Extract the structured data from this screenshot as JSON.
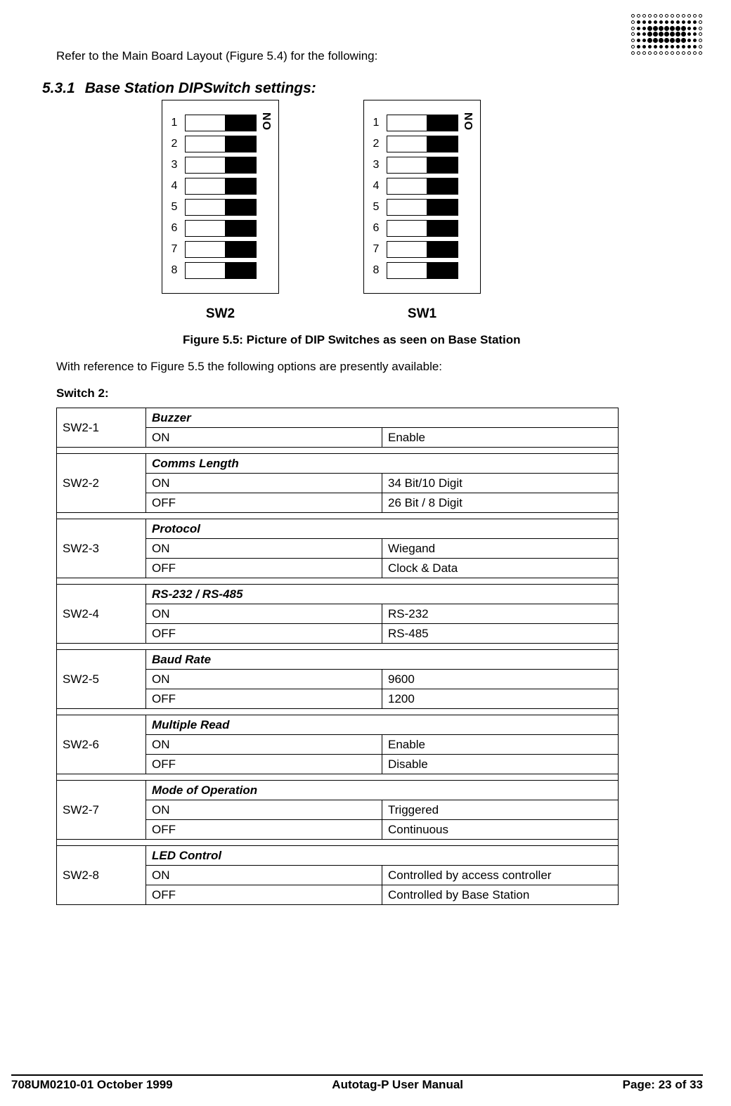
{
  "intro_text": "Refer to the Main Board Layout (Figure 5.4) for the following:",
  "section": {
    "number": "5.3.1",
    "title": "Base Station DIPSwitch settings:"
  },
  "dip": {
    "on_label": "ON",
    "sw2": {
      "name": "SW2",
      "switches": [
        {
          "n": "1",
          "state": "on"
        },
        {
          "n": "2",
          "state": "on"
        },
        {
          "n": "3",
          "state": "on"
        },
        {
          "n": "4",
          "state": "on"
        },
        {
          "n": "5",
          "state": "on"
        },
        {
          "n": "6",
          "state": "on"
        },
        {
          "n": "7",
          "state": "on"
        },
        {
          "n": "8",
          "state": "on"
        }
      ]
    },
    "sw1": {
      "name": "SW1",
      "switches": [
        {
          "n": "1",
          "state": "on"
        },
        {
          "n": "2",
          "state": "on"
        },
        {
          "n": "3",
          "state": "on"
        },
        {
          "n": "4",
          "state": "on"
        },
        {
          "n": "5",
          "state": "on"
        },
        {
          "n": "6",
          "state": "on"
        },
        {
          "n": "7",
          "state": "on"
        },
        {
          "n": "8",
          "state": "on"
        }
      ]
    }
  },
  "figure_caption": "Figure 5.5: Picture of DIP Switches as seen on Base Station",
  "para_options": "With reference to Figure 5.5 the following options are presently available:",
  "switch2_label": "Switch 2:",
  "table": [
    {
      "switch": "SW2-1",
      "title": "Buzzer",
      "rows": [
        {
          "state": "ON",
          "desc": "Enable"
        }
      ]
    },
    {
      "switch": "SW2-2",
      "title": "Comms Length",
      "rows": [
        {
          "state": "ON",
          "desc": "34 Bit/10 Digit"
        },
        {
          "state": "OFF",
          "desc": "26 Bit / 8 Digit"
        }
      ]
    },
    {
      "switch": "SW2-3",
      "title": "Protocol",
      "rows": [
        {
          "state": "ON",
          "desc": "Wiegand"
        },
        {
          "state": "OFF",
          "desc": "Clock & Data"
        }
      ]
    },
    {
      "switch": "SW2-4",
      "title": "RS-232 / RS-485",
      "rows": [
        {
          "state": "ON",
          "desc": "RS-232"
        },
        {
          "state": "OFF",
          "desc": "RS-485"
        }
      ]
    },
    {
      "switch": "SW2-5",
      "title": "Baud Rate",
      "rows": [
        {
          "state": "ON",
          "desc": "9600"
        },
        {
          "state": "OFF",
          "desc": "1200"
        }
      ]
    },
    {
      "switch": "SW2-6",
      "title": "Multiple Read",
      "rows": [
        {
          "state": "ON",
          "desc": "Enable"
        },
        {
          "state": "OFF",
          "desc": "Disable"
        }
      ]
    },
    {
      "switch": "SW2-7",
      "title": "Mode of Operation",
      "rows": [
        {
          "state": "ON",
          "desc": "Triggered"
        },
        {
          "state": "OFF",
          "desc": "Continuous"
        }
      ]
    },
    {
      "switch": "SW2-8",
      "title": "LED Control",
      "rows": [
        {
          "state": "ON",
          "desc": "Controlled by access controller"
        },
        {
          "state": "OFF",
          "desc": "Controlled by Base Station"
        }
      ]
    }
  ],
  "footer": {
    "left": "708UM0210-01 October 1999",
    "center": "Autotag-P User Manual",
    "right": "Page: 23 of 33"
  }
}
